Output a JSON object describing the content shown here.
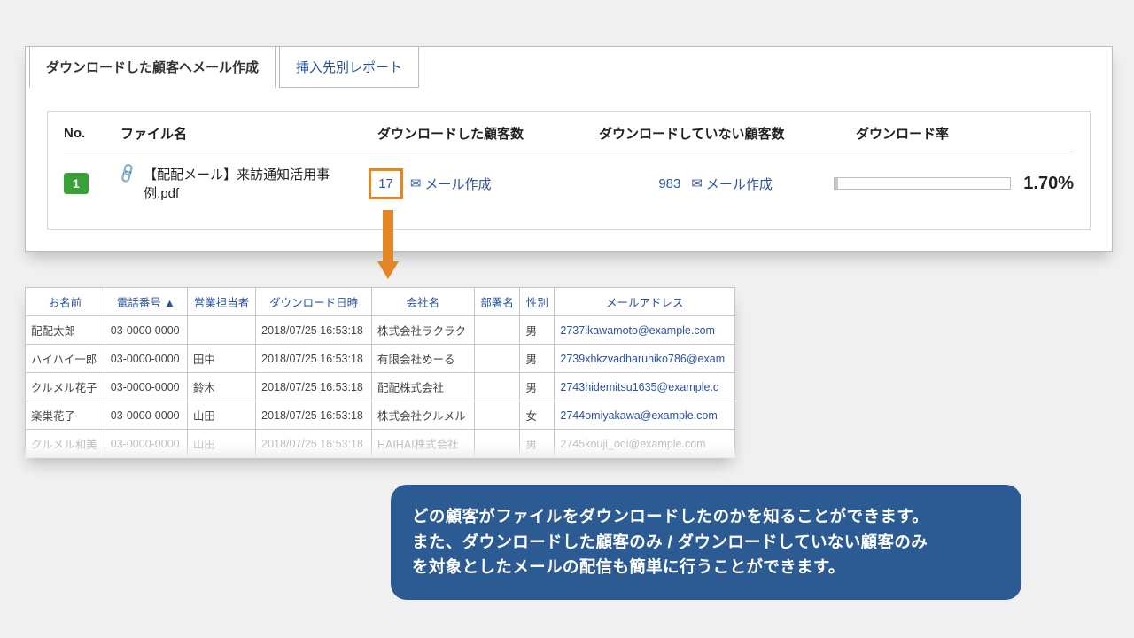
{
  "tabs": [
    {
      "label": "ダウンロードした顧客へメール作成",
      "active": true
    },
    {
      "label": "挿入先別レポート",
      "active": false
    }
  ],
  "headers": {
    "no": "No.",
    "file": "ファイル名",
    "dl": "ダウンロードした顧客数",
    "ndl": "ダウンロードしていない顧客数",
    "rate": "ダウンロード率"
  },
  "row": {
    "no": "1",
    "file": "【配配メール】来訪通知活用事例.pdf",
    "dl_count": "17",
    "ndl_count": "983",
    "mail": "メール作成",
    "rate": "1.70%"
  },
  "cust_headers": {
    "name": "お名前",
    "tel": "電話番号 ▲",
    "sales": "営業担当者",
    "dl_date": "ダウンロード日時",
    "company": "会社名",
    "dept": "部署名",
    "gender": "性別",
    "email": "メールアドレス"
  },
  "customers": [
    {
      "name": "配配太郎",
      "tel": "03-0000-0000",
      "sales": "",
      "date": "2018/07/25 16:53:18",
      "company": "株式会社ラクラク",
      "dept": "",
      "gender": "男",
      "email": "2737ikawamoto@example.com"
    },
    {
      "name": "ハイハイ一郎",
      "tel": "03-0000-0000",
      "sales": "田中",
      "date": "2018/07/25 16:53:18",
      "company": "有限会社めーる",
      "dept": "",
      "gender": "男",
      "email": "2739xhkzvadharuhiko786@exam"
    },
    {
      "name": "クルメル花子",
      "tel": "03-0000-0000",
      "sales": "鈴木",
      "date": "2018/07/25 16:53:18",
      "company": "配配株式会社",
      "dept": "",
      "gender": "男",
      "email": "2743hidemitsu1635@example.c"
    },
    {
      "name": "楽巣花子",
      "tel": "03-0000-0000",
      "sales": "山田",
      "date": "2018/07/25 16:53:18",
      "company": "株式会社クルメル",
      "dept": "",
      "gender": "女",
      "email": "2744omiyakawa@example.com"
    },
    {
      "name": "クルメル和美",
      "tel": "03-0000-0000",
      "sales": "山田",
      "date": "2018/07/25 16:53:18",
      "company": "HAIHAI株式会社",
      "dept": "",
      "gender": "男",
      "email": "2745kouji_ooi@example.com"
    }
  ],
  "callout": {
    "l1": "どの顧客がファイルをダウンロードしたのかを知ることができます。",
    "l2": "また、ダウンロードした顧客のみ / ダウンロードしていない顧客のみ",
    "l3": "を対象としたメールの配信も簡単に行うことができます。"
  }
}
